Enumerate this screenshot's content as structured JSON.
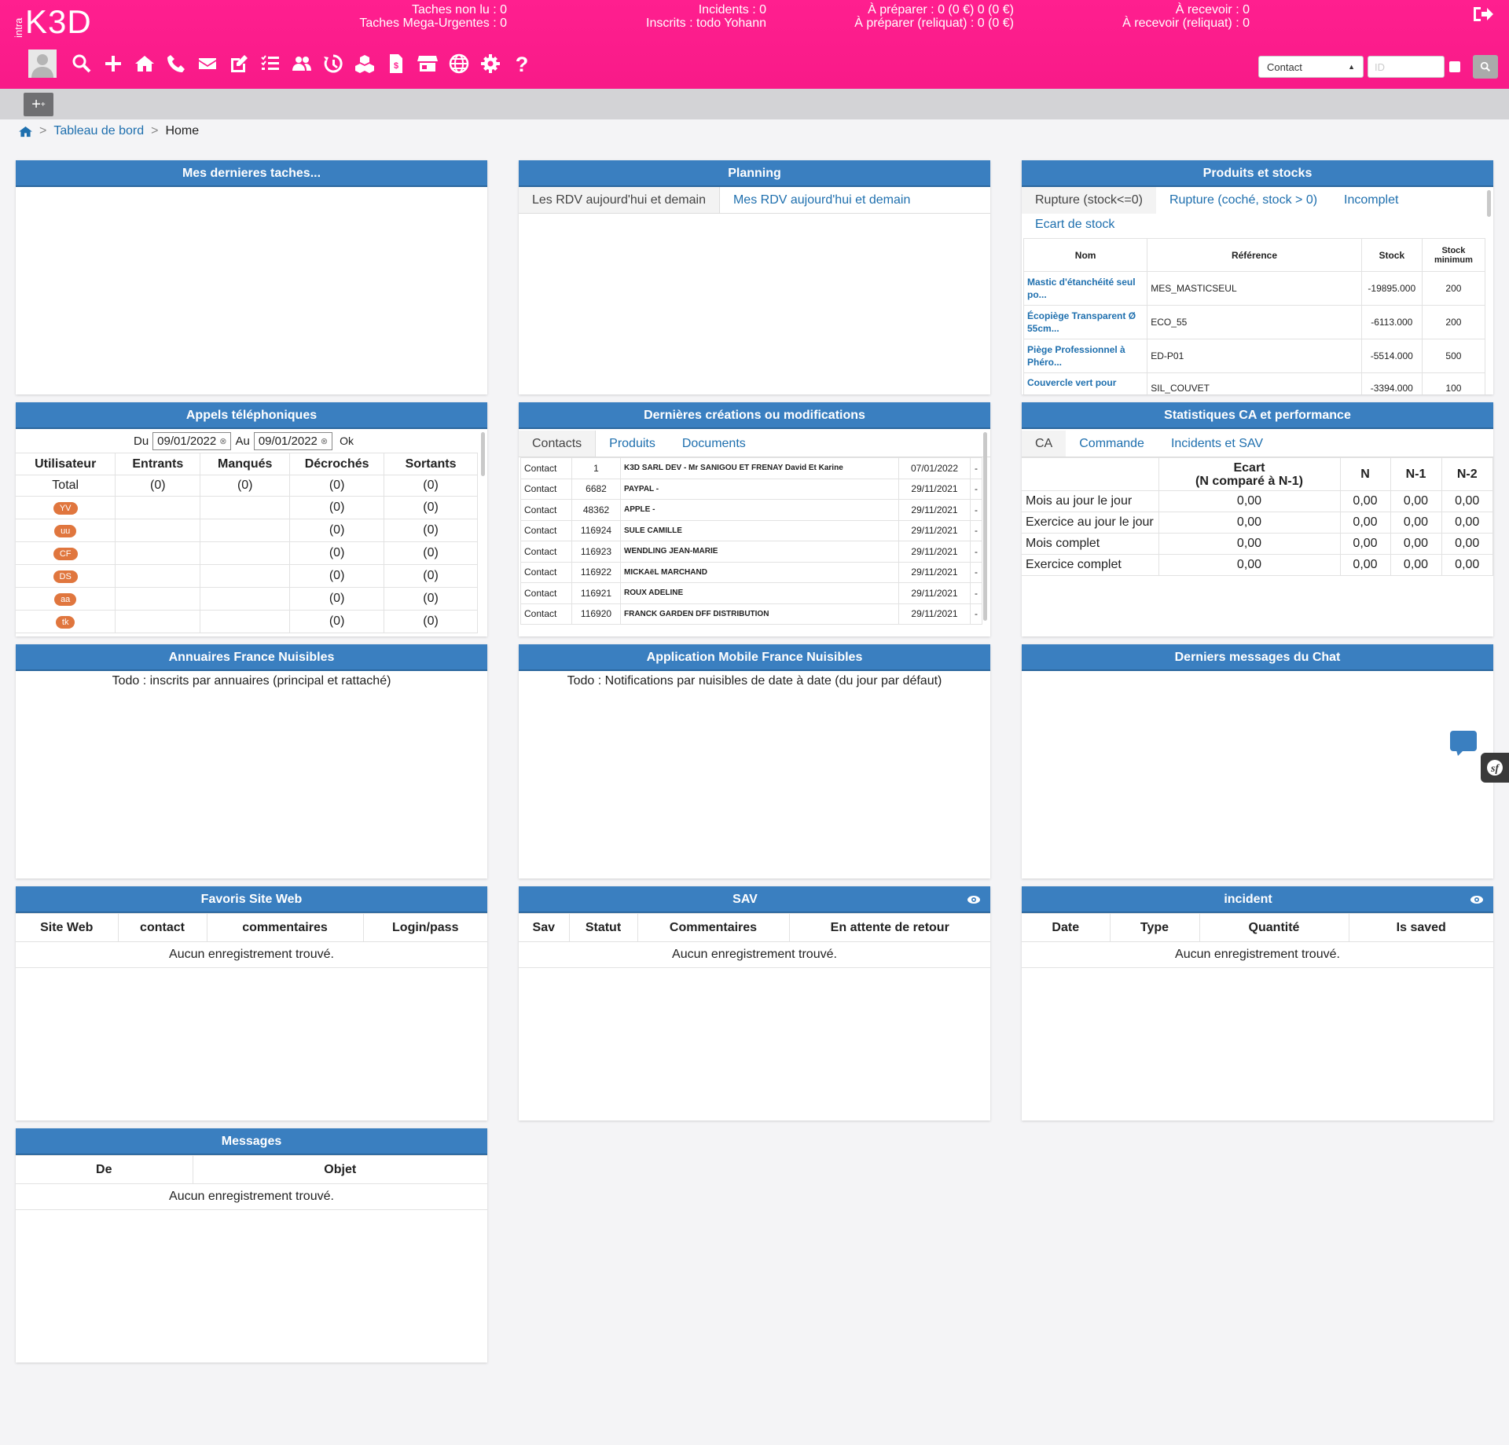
{
  "app": {
    "logo_small": "intra",
    "logo": "K3D"
  },
  "header": {
    "stats": [
      {
        "line1": "Taches non lu : 0",
        "line2": "Taches Mega-Urgentes : 0"
      },
      {
        "line1": "Incidents : 0",
        "line2": "Inscrits : todo Yohann"
      },
      {
        "line1": "À préparer : 0 (0 €) 0 (0 €)",
        "line2": "À préparer (reliquat) : 0 (0 €)"
      },
      {
        "line1": "À recevoir : 0",
        "line2": "À recevoir (reliquat) : 0"
      }
    ],
    "search": {
      "select_value": "Contact",
      "id_placeholder": "ID"
    },
    "icons": [
      "search-icon",
      "plus-icon",
      "home-icon",
      "phone-icon",
      "envelope-icon",
      "edit-icon",
      "tasks-icon",
      "users-icon",
      "history-icon",
      "cubes-icon",
      "invoice-icon",
      "store-icon",
      "globe-icon",
      "gear-icon",
      "question-icon"
    ]
  },
  "toolbar": {
    "add_label": "+"
  },
  "breadcrumb": {
    "dashboard": "Tableau de bord",
    "current": "Home",
    "sep": ">"
  },
  "panels": {
    "tasks": {
      "title": "Mes dernieres taches..."
    },
    "planning": {
      "title": "Planning",
      "tabs": [
        "Les RDV aujourd'hui et demain",
        "Mes RDV aujourd'hui et demain"
      ]
    },
    "products": {
      "title": "Produits et stocks",
      "tabs": [
        "Rupture (stock<=0)",
        "Rupture (coché, stock > 0)",
        "Incomplet",
        "Ecart de stock"
      ],
      "headers": [
        "Nom",
        "Référence",
        "Stock",
        "Stock minimum"
      ],
      "rows": [
        {
          "name": "Mastic d'étanchéité seul po...",
          "ref": "MES_MASTICSEUL",
          "stock": "-19895.000",
          "min": "200"
        },
        {
          "name": "Écopiège Transparent Ø 55cm...",
          "ref": "ECO_55",
          "stock": "-6113.000",
          "min": "200"
        },
        {
          "name": "Piège Professionnel à Phéro...",
          "ref": "ED-P01",
          "stock": "-5514.000",
          "min": "500"
        },
        {
          "name": "Couvercle vert pour",
          "ref": "SIL_COUVET",
          "stock": "-3394.000",
          "min": "100"
        }
      ]
    },
    "calls": {
      "title": "Appels téléphoniques",
      "from_label": "Du",
      "from": "09/01/2022",
      "to_label": "Au",
      "to": "09/01/2022",
      "ok": "Ok",
      "headers": [
        "Utilisateur",
        "Entrants",
        "Manqués",
        "Décrochés",
        "Sortants"
      ],
      "total": {
        "user": "Total",
        "in": "(0)",
        "missed": "(0)",
        "picked": "(0)",
        "out": "(0)"
      },
      "rows": [
        {
          "user": "YV",
          "picked": "(0)",
          "out": "(0)"
        },
        {
          "user": "uu",
          "picked": "(0)",
          "out": "(0)"
        },
        {
          "user": "CF",
          "picked": "(0)",
          "out": "(0)"
        },
        {
          "user": "DS",
          "picked": "(0)",
          "out": "(0)"
        },
        {
          "user": "aa",
          "picked": "(0)",
          "out": "(0)"
        },
        {
          "user": "tk",
          "picked": "(0)",
          "out": "(0)"
        }
      ]
    },
    "latest": {
      "title": "Dernières créations ou modifications",
      "tabs": [
        "Contacts",
        "Produits",
        "Documents"
      ],
      "rows": [
        {
          "type": "Contact",
          "id": "1",
          "name": "K3D SARL DEV - Mr SANIGOU ET FRENAY David Et Karine",
          "date": "07/01/2022",
          "x": "-"
        },
        {
          "type": "Contact",
          "id": "6682",
          "name": "PAYPAL -",
          "date": "29/11/2021",
          "x": "-"
        },
        {
          "type": "Contact",
          "id": "48362",
          "name": "APPLE -",
          "date": "29/11/2021",
          "x": "-"
        },
        {
          "type": "Contact",
          "id": "116924",
          "name": "SULE CAMILLE",
          "date": "29/11/2021",
          "x": "-"
        },
        {
          "type": "Contact",
          "id": "116923",
          "name": "WENDLING JEAN-MARIE",
          "date": "29/11/2021",
          "x": "-"
        },
        {
          "type": "Contact",
          "id": "116922",
          "name": "MICKAëL MARCHAND",
          "date": "29/11/2021",
          "x": "-"
        },
        {
          "type": "Contact",
          "id": "116921",
          "name": "ROUX ADELINE",
          "date": "29/11/2021",
          "x": "-"
        },
        {
          "type": "Contact",
          "id": "116920",
          "name": "FRANCK GARDEN DFF DISTRIBUTION",
          "date": "29/11/2021",
          "x": "-"
        }
      ]
    },
    "stats": {
      "title": "Statistiques CA et performance",
      "tabs": [
        "CA",
        "Commande",
        "Incidents et SAV"
      ],
      "headers": [
        "Ecart",
        "(N comparé à N-1)",
        "N",
        "N-1",
        "N-2"
      ],
      "rows": [
        {
          "label": "Mois au jour le jour",
          "ecart": "0,00",
          "n": "0,00",
          "n1": "0,00",
          "n2": "0,00"
        },
        {
          "label": "Exercice au jour le jour",
          "ecart": "0,00",
          "n": "0,00",
          "n1": "0,00",
          "n2": "0,00"
        },
        {
          "label": "Mois complet",
          "ecart": "0,00",
          "n": "0,00",
          "n1": "0,00",
          "n2": "0,00"
        },
        {
          "label": "Exercice complet",
          "ecart": "0,00",
          "n": "0,00",
          "n1": "0,00",
          "n2": "0,00"
        }
      ]
    },
    "annuaires": {
      "title": "Annuaires France Nuisibles",
      "text": "Todo : inscrits par annuaires (principal et rattaché)"
    },
    "mobile": {
      "title": "Application Mobile France Nuisibles",
      "text": "Todo : Notifications par nuisibles de date à date (du jour par défaut)"
    },
    "chat": {
      "title": "Derniers messages du Chat"
    },
    "favoris": {
      "title": "Favoris Site Web",
      "headers": [
        "Site Web",
        "contact",
        "commentaires",
        "Login/pass"
      ],
      "empty": "Aucun enregistrement trouvé."
    },
    "sav": {
      "title": "SAV",
      "headers": [
        "Sav",
        "Statut",
        "Commentaires",
        "En attente de retour"
      ],
      "empty": "Aucun enregistrement trouvé."
    },
    "incident": {
      "title": "incident",
      "headers": [
        "Date",
        "Type",
        "Quantité",
        "Is saved"
      ],
      "empty": "Aucun enregistrement trouvé."
    },
    "messages": {
      "title": "Messages",
      "headers": [
        "De",
        "Objet"
      ],
      "empty": "Aucun enregistrement trouvé."
    }
  },
  "colors": {
    "brand": "#ff1f8f",
    "panel_header": "#3a7fc0",
    "link": "#1e6fae",
    "pill": "#e0763e"
  }
}
